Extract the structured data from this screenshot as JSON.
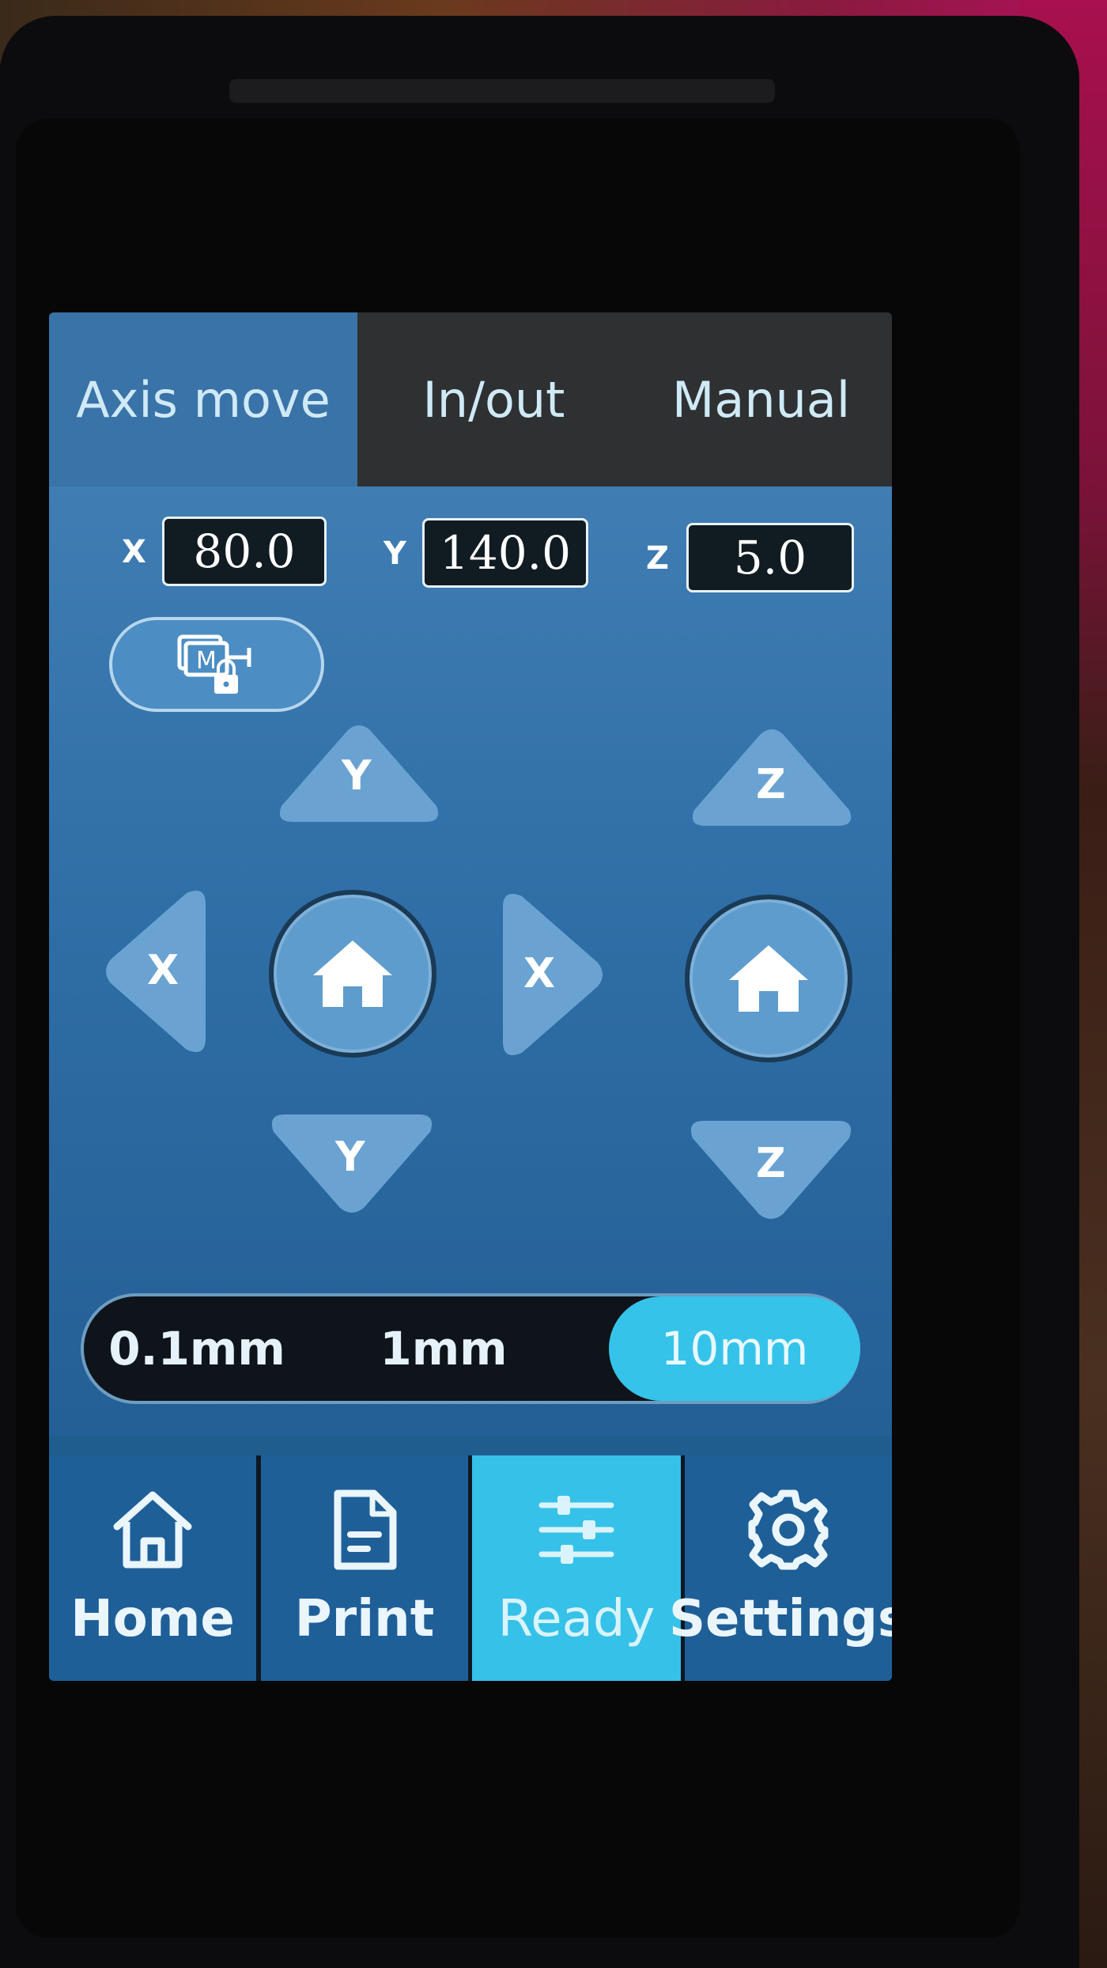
{
  "tabs": [
    {
      "label": "Axis move",
      "active": true
    },
    {
      "label": "In/out",
      "active": false
    },
    {
      "label": "Manual",
      "active": false
    }
  ],
  "coords": {
    "x": {
      "label": "X",
      "value": "80.0"
    },
    "y": {
      "label": "Y",
      "value": "140.0"
    },
    "z": {
      "label": "Z",
      "value": "5.0"
    }
  },
  "motor_lock": {
    "icon": "motor-lock-icon"
  },
  "jog": {
    "y_plus": "Y",
    "y_minus": "Y",
    "x_minus": "X",
    "x_plus": "X",
    "z_plus": "Z",
    "z_minus": "Z",
    "home_xy": {
      "icon": "home-icon"
    },
    "home_z": {
      "icon": "home-icon"
    }
  },
  "step_sizes": [
    {
      "label": "0.1mm",
      "active": false
    },
    {
      "label": "1mm",
      "active": false
    },
    {
      "label": "10mm",
      "active": true
    }
  ],
  "nav": [
    {
      "label": "Home",
      "icon": "home-icon",
      "active": false
    },
    {
      "label": "Print",
      "icon": "document-icon",
      "active": false
    },
    {
      "label": "Ready",
      "icon": "sliders-icon",
      "active": true
    },
    {
      "label": "Settings",
      "icon": "gear-icon",
      "active": false
    }
  ],
  "colors": {
    "screen_bg": "#2f6ea6",
    "accent": "#36c1e8",
    "tab_bar": "#2f3032",
    "active_tab": "#3a73a8",
    "button": "#6aa3d2"
  }
}
